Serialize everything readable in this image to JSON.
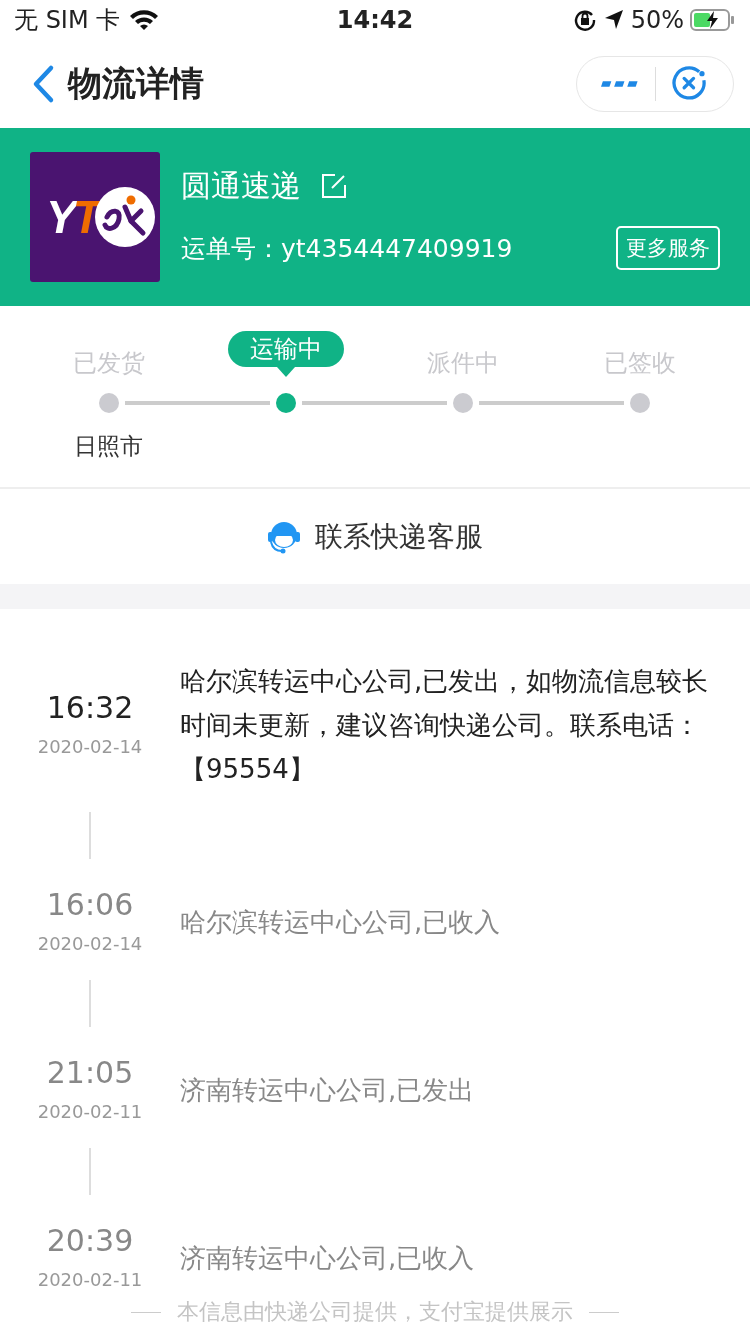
{
  "status_bar": {
    "carrier": "无 SIM 卡",
    "time": "14:42",
    "battery": "50%"
  },
  "nav": {
    "title": "物流详情"
  },
  "courier": {
    "logo_left": "Y",
    "logo_right": "T",
    "name": "圆通速递",
    "waybill": "运单号：yt4354447409919",
    "more_button": "更多服务"
  },
  "progress": [
    {
      "label": "已发货",
      "selected": false,
      "place": "日照市"
    },
    {
      "label": "运输中",
      "selected": true
    },
    {
      "label": "派件中",
      "selected": false
    },
    {
      "label": "已签收",
      "selected": false
    }
  ],
  "contact": {
    "label": "联系快递客服"
  },
  "events": [
    {
      "time": "16:32",
      "date": "2020-02-14",
      "text": "哈尔滨转运中心公司,已发出，如物流信息较长时间未更新，建议咨询快递公司。联系电话：【95554】",
      "latest": true
    },
    {
      "time": "16:06",
      "date": "2020-02-14",
      "text": "哈尔滨转运中心公司,已收入",
      "latest": false
    },
    {
      "time": "21:05",
      "date": "2020-02-11",
      "text": "济南转运中心公司,已发出",
      "latest": false
    },
    {
      "time": "20:39",
      "date": "2020-02-11",
      "text": "济南转运中心公司,已收入",
      "latest": false
    }
  ],
  "footer": "本信息由快递公司提供，支付宝提供展示"
}
